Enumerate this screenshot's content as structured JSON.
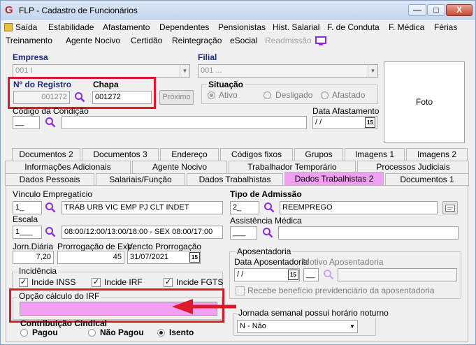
{
  "window": {
    "title": "FLP - Cadastro de Funcionários",
    "app_icon": "G",
    "minimize": "—",
    "maximize": "□",
    "close": "X"
  },
  "menu": {
    "row1": [
      "Saída",
      "Estabilidade",
      "Afastamento",
      "Dependentes",
      "Pensionistas",
      "Hist. Salarial",
      "F. de Conduta",
      "F. Médica",
      "Férias"
    ],
    "row2": [
      "Treinamento",
      "Agente Nocivo",
      "Certidão",
      "Reintegração",
      "eSocial",
      "Readmissão"
    ]
  },
  "empresa": {
    "label": "Empresa",
    "value": "001 I"
  },
  "filial": {
    "label": "Filial",
    "value": "001 ..."
  },
  "registro": {
    "label": "Nº do Registro",
    "value": "001272"
  },
  "chapa": {
    "label": "Chapa",
    "value": "001272"
  },
  "proximo_button": "Próximo",
  "situacao": {
    "label": "Situação",
    "options": [
      "Ativo",
      "Desligado",
      "Afastado"
    ],
    "selected": "Ativo"
  },
  "codigo_condicao": {
    "label": "Código da Condição",
    "value": "__"
  },
  "data_afastamento": {
    "label": "Data Afastamento",
    "value": "/ /",
    "icon": "15"
  },
  "photo_label": "Foto",
  "tabs": {
    "row1": [
      "Documentos 2",
      "Documentos 3",
      "Endereço",
      "Códigos fixos",
      "Grupos",
      "Imagens 1",
      "Imagens 2"
    ],
    "row2": [
      "Informações Adicionais",
      "Agente Nocivo",
      "Trabalhador Temporário",
      "Processos Judiciais"
    ],
    "row3": [
      "Dados Pessoais",
      "Salariais/Função",
      "Dados Trabalhistas",
      "Dados Trabalhistas 2",
      "Documentos 1"
    ],
    "active": "Dados Trabalhistas 2"
  },
  "vinculo": {
    "label": "Vínculo Empregatício",
    "code": "1_",
    "desc": "TRAB URB VIC EMP PJ CLT INDET"
  },
  "tipo_admissao": {
    "label": "Tipo de Admissão",
    "code": "2_",
    "desc": "REEMPREGO"
  },
  "escala": {
    "label": "Escala",
    "code": "1___",
    "desc": "08:00/12:00/13:00/18:00 - SEX 08:00/17:00"
  },
  "assistencia": {
    "label": "Assistência Médica",
    "code": "___",
    "desc": ""
  },
  "jorn_diaria": {
    "label": "Jorn.Diária",
    "value": "7,20"
  },
  "prorrogacao": {
    "label": "Prorrogação de Exp.",
    "value": "45"
  },
  "vencto": {
    "label": "Vencto Prorrogação",
    "value": "31/07/2021",
    "icon": "15"
  },
  "aposentadoria": {
    "group_label": "Aposentadoria",
    "data_label": "Data Aposentadoria",
    "data_value": "/ /",
    "icon": "15",
    "motivo_label": "Motivo Aposentadoria",
    "motivo_code": "__",
    "beneficio_label": "Recebe benefício previdenciário da aposentadoria"
  },
  "incidencia": {
    "label": "Incidência",
    "items": [
      "Incide INSS",
      "Incide IRF",
      "Incide FGTS"
    ]
  },
  "opcao_irf": {
    "label": "Opção cálculo do IRF",
    "value": ""
  },
  "jornada_noturno": {
    "label": "Jornada semanal possui horário noturno",
    "value": "N - Não"
  },
  "contribuicao": {
    "label": "Contribuição Cindical",
    "options": [
      "Pagou",
      "Não Pagou",
      "Isento"
    ],
    "selected": "Isento"
  },
  "colors": {
    "highlight": "#dd1a2a",
    "active_tab": "#f0a0f0",
    "pink_field": "#f59ef5",
    "label_navy": "#1e2a78",
    "icon_purple": "#8a2be2"
  }
}
